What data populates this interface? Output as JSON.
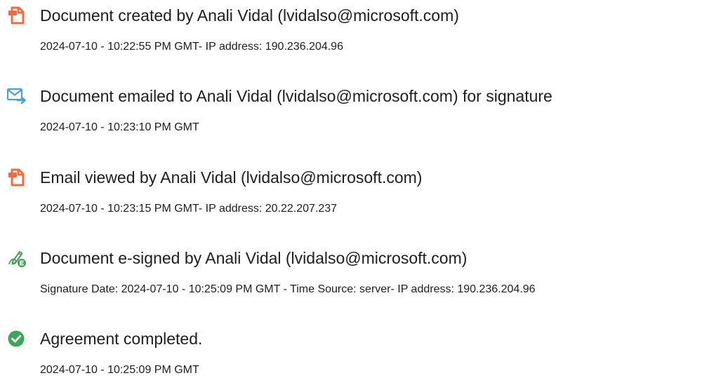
{
  "audit_trail": {
    "events": [
      {
        "icon": "document-created-icon",
        "title": "Document created by Anali Vidal (lvidalso@microsoft.com)",
        "detail": "2024-07-10 - 10:22:55 PM GMT- IP address: 190.236.204.96"
      },
      {
        "icon": "email-sent-icon",
        "title": "Document emailed to Anali Vidal (lvidalso@microsoft.com) for signature",
        "detail": "2024-07-10 - 10:23:10 PM GMT"
      },
      {
        "icon": "email-viewed-icon",
        "title": "Email viewed by Anali Vidal (lvidalso@microsoft.com)",
        "detail": "2024-07-10 - 10:23:15 PM GMT- IP address: 20.22.207.237"
      },
      {
        "icon": "e-signed-icon",
        "title": "Document e-signed by Anali Vidal (lvidalso@microsoft.com)",
        "detail": "Signature Date: 2024-07-10 - 10:25:09 PM GMT - Time Source: server- IP address: 190.236.204.96"
      },
      {
        "icon": "agreement-completed-icon",
        "title": "Agreement completed.",
        "detail": "2024-07-10 - 10:25:09 PM GMT"
      }
    ]
  },
  "colors": {
    "document_icon": "#f26b43",
    "email_icon": "#4a9ee8",
    "esign_icon": "#4b9e58",
    "completed_icon": "#3aa758",
    "text": "#1e1e1e"
  }
}
